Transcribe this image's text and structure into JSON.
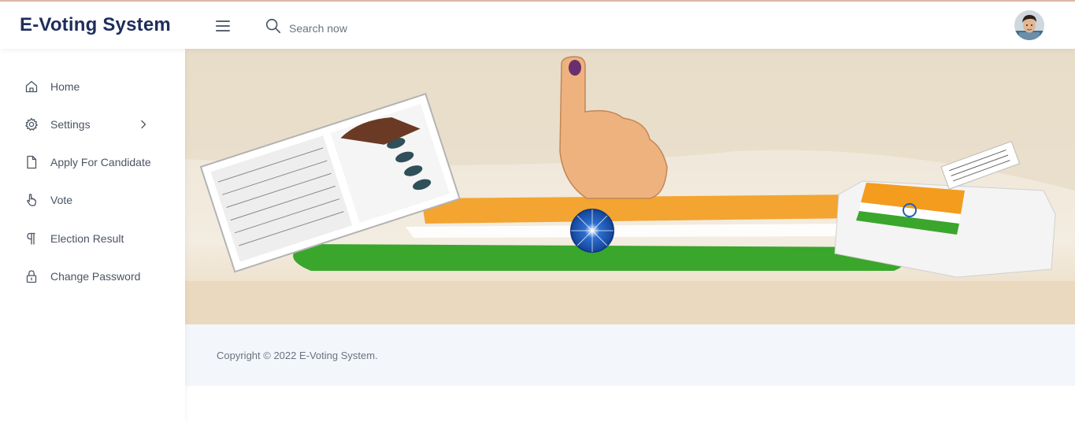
{
  "header": {
    "brand": "E-Voting System",
    "search": {
      "placeholder": "Search now"
    }
  },
  "sidebar": {
    "items": [
      {
        "label": "Home",
        "icon": "home-icon"
      },
      {
        "label": "Settings",
        "icon": "gear-icon",
        "has_submenu": true
      },
      {
        "label": "Apply For Candidate",
        "icon": "file-icon"
      },
      {
        "label": "Vote",
        "icon": "hand-pointer-icon"
      },
      {
        "label": "Election Result",
        "icon": "paragraph-icon"
      },
      {
        "label": "Change Password",
        "icon": "lock-icon"
      }
    ]
  },
  "footer": {
    "copyright": "Copyright © 2022 E-Voting System."
  },
  "colors": {
    "brand": "#1f2d5c",
    "text_muted": "#4b5563",
    "footer_bg": "#f3f6fb",
    "saffron": "#f39c1e",
    "green": "#3aa62c",
    "chakra_blue": "#1f5fb8"
  }
}
